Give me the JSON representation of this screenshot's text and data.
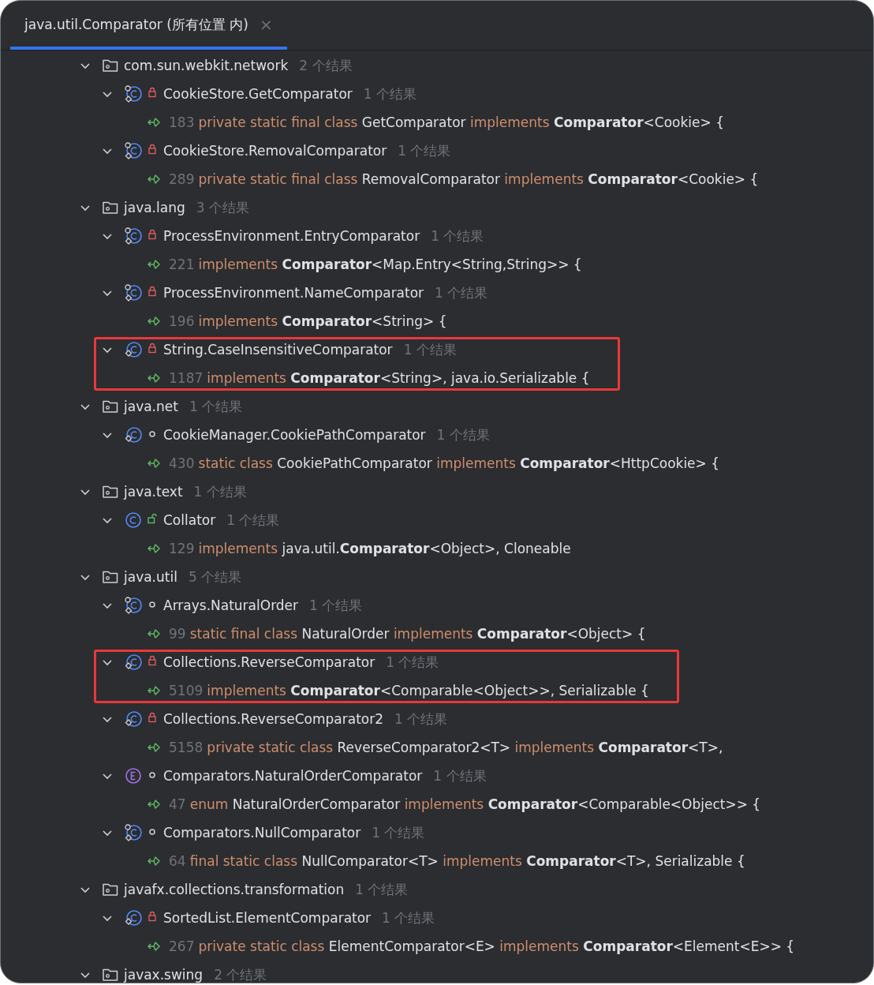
{
  "tabs": [
    {
      "label": "java.util.Comparator (所有位置 内)",
      "close": "×",
      "selected": true
    }
  ],
  "tree": [
    {
      "name": "com.sun.webkit.network",
      "count": "2 个结果",
      "expanded": true,
      "children": [
        {
          "name": "CookieStore.GetComparator",
          "count": "1 个结果",
          "kind": "nested",
          "modifier": {
            "kind": "private"
          },
          "expanded": true,
          "highlighted": false,
          "children": [
            {
              "line": "183",
              "segments": [
                {
                  "kind": "keyword",
                  "text": "private static final class "
                },
                {
                  "kind": "text",
                  "text": "GetComparator "
                },
                {
                  "kind": "keyword",
                  "text": "implements "
                },
                {
                  "kind": "bold",
                  "text": "Comparator"
                },
                {
                  "kind": "text",
                  "text": "<Cookie> {"
                }
              ]
            }
          ]
        },
        {
          "name": "CookieStore.RemovalComparator",
          "count": "1 个结果",
          "kind": "nested",
          "modifier": {
            "kind": "private"
          },
          "expanded": true,
          "highlighted": false,
          "children": [
            {
              "line": "289",
              "segments": [
                {
                  "kind": "keyword",
                  "text": "private static final class "
                },
                {
                  "kind": "text",
                  "text": "RemovalComparator "
                },
                {
                  "kind": "keyword",
                  "text": "implements "
                },
                {
                  "kind": "bold",
                  "text": "Comparator"
                },
                {
                  "kind": "text",
                  "text": "<Cookie> {"
                }
              ]
            }
          ]
        }
      ]
    },
    {
      "name": "java.lang",
      "count": "3 个结果",
      "expanded": true,
      "children": [
        {
          "name": "ProcessEnvironment.EntryComparator",
          "count": "1 个结果",
          "kind": "nested",
          "modifier": {
            "kind": "private"
          },
          "expanded": true,
          "highlighted": false,
          "children": [
            {
              "line": "221",
              "segments": [
                {
                  "kind": "keyword",
                  "text": "implements "
                },
                {
                  "kind": "bold",
                  "text": "Comparator"
                },
                {
                  "kind": "text",
                  "text": "<Map.Entry<String,String>> {"
                }
              ]
            }
          ]
        },
        {
          "name": "ProcessEnvironment.NameComparator",
          "count": "1 个结果",
          "kind": "nested",
          "modifier": {
            "kind": "private"
          },
          "expanded": true,
          "highlighted": false,
          "children": [
            {
              "line": "196",
              "segments": [
                {
                  "kind": "keyword",
                  "text": "implements "
                },
                {
                  "kind": "bold",
                  "text": "Comparator"
                },
                {
                  "kind": "text",
                  "text": "<String> {"
                }
              ]
            }
          ]
        },
        {
          "name": "String.CaseInsensitiveComparator",
          "count": "1 个结果",
          "kind": "inner",
          "modifier": {
            "kind": "private"
          },
          "expanded": true,
          "highlighted": true,
          "children": [
            {
              "line": "1187",
              "segments": [
                {
                  "kind": "keyword",
                  "text": "implements "
                },
                {
                  "kind": "bold",
                  "text": "Comparator"
                },
                {
                  "kind": "text",
                  "text": "<String>, java.io.Serializable {"
                }
              ]
            }
          ]
        }
      ]
    },
    {
      "name": "java.net",
      "count": "1 个结果",
      "expanded": true,
      "children": [
        {
          "name": "CookieManager.CookiePathComparator",
          "count": "1 个结果",
          "kind": "inner",
          "modifier": {
            "kind": "package"
          },
          "expanded": true,
          "highlighted": false,
          "children": [
            {
              "line": "430",
              "segments": [
                {
                  "kind": "keyword",
                  "text": "static class "
                },
                {
                  "kind": "text",
                  "text": "CookiePathComparator "
                },
                {
                  "kind": "keyword",
                  "text": "implements "
                },
                {
                  "kind": "bold",
                  "text": "Comparator"
                },
                {
                  "kind": "text",
                  "text": "<HttpCookie> {"
                }
              ]
            }
          ]
        }
      ]
    },
    {
      "name": "java.text",
      "count": "1 个结果",
      "expanded": true,
      "children": [
        {
          "name": "Collator",
          "count": "1 个结果",
          "kind": "class",
          "modifier": {
            "kind": "public"
          },
          "expanded": true,
          "highlighted": false,
          "children": [
            {
              "line": "129",
              "segments": [
                {
                  "kind": "keyword",
                  "text": "implements "
                },
                {
                  "kind": "text",
                  "text": "java.util."
                },
                {
                  "kind": "bold",
                  "text": "Comparator"
                },
                {
                  "kind": "text",
                  "text": "<Object>, Cloneable"
                }
              ]
            }
          ]
        }
      ]
    },
    {
      "name": "java.util",
      "count": "5 个结果",
      "expanded": true,
      "children": [
        {
          "name": "Arrays.NaturalOrder",
          "count": "1 个结果",
          "kind": "nested",
          "modifier": {
            "kind": "package"
          },
          "expanded": true,
          "highlighted": false,
          "children": [
            {
              "line": "99",
              "segments": [
                {
                  "kind": "keyword",
                  "text": "static final class "
                },
                {
                  "kind": "text",
                  "text": "NaturalOrder "
                },
                {
                  "kind": "keyword",
                  "text": "implements "
                },
                {
                  "kind": "bold",
                  "text": "Comparator"
                },
                {
                  "kind": "text",
                  "text": "<Object> {"
                }
              ]
            }
          ]
        },
        {
          "name": "Collections.ReverseComparator",
          "count": "1 个结果",
          "kind": "inner",
          "modifier": {
            "kind": "private"
          },
          "expanded": true,
          "highlighted": true,
          "children": [
            {
              "line": "5109",
              "segments": [
                {
                  "kind": "keyword",
                  "text": "implements "
                },
                {
                  "kind": "bold",
                  "text": "Comparator"
                },
                {
                  "kind": "text",
                  "text": "<Comparable<Object>>, Serializable {"
                }
              ]
            }
          ]
        },
        {
          "name": "Collections.ReverseComparator2",
          "count": "1 个结果",
          "kind": "inner",
          "modifier": {
            "kind": "private"
          },
          "expanded": true,
          "highlighted": false,
          "children": [
            {
              "line": "5158",
              "segments": [
                {
                  "kind": "keyword",
                  "text": "private static class "
                },
                {
                  "kind": "text",
                  "text": "ReverseComparator2<T> "
                },
                {
                  "kind": "keyword",
                  "text": "implements "
                },
                {
                  "kind": "bold",
                  "text": "Comparator"
                },
                {
                  "kind": "text",
                  "text": "<T>,"
                }
              ]
            }
          ]
        },
        {
          "name": "Comparators.NaturalOrderComparator",
          "count": "1 个结果",
          "kind": "enum",
          "modifier": {
            "kind": "package"
          },
          "expanded": true,
          "highlighted": false,
          "children": [
            {
              "line": "47",
              "segments": [
                {
                  "kind": "keyword",
                  "text": "enum "
                },
                {
                  "kind": "text",
                  "text": "NaturalOrderComparator "
                },
                {
                  "kind": "keyword",
                  "text": "implements "
                },
                {
                  "kind": "bold",
                  "text": "Comparator"
                },
                {
                  "kind": "text",
                  "text": "<Comparable<Object>> {"
                }
              ]
            }
          ]
        },
        {
          "name": "Comparators.NullComparator",
          "count": "1 个结果",
          "kind": "nested",
          "modifier": {
            "kind": "package"
          },
          "expanded": true,
          "highlighted": false,
          "children": [
            {
              "line": "64",
              "segments": [
                {
                  "kind": "keyword",
                  "text": "final static class "
                },
                {
                  "kind": "text",
                  "text": "NullComparator<T> "
                },
                {
                  "kind": "keyword",
                  "text": "implements "
                },
                {
                  "kind": "bold",
                  "text": "Comparator"
                },
                {
                  "kind": "text",
                  "text": "<T>, Serializable {"
                }
              ]
            }
          ]
        }
      ]
    },
    {
      "name": "javafx.collections.transformation",
      "count": "1 个结果",
      "expanded": true,
      "children": [
        {
          "name": "SortedList.ElementComparator",
          "count": "1 个结果",
          "kind": "inner",
          "modifier": {
            "kind": "private"
          },
          "expanded": true,
          "highlighted": false,
          "children": [
            {
              "line": "267",
              "segments": [
                {
                  "kind": "keyword",
                  "text": "private static class "
                },
                {
                  "kind": "text",
                  "text": "ElementComparator<E> "
                },
                {
                  "kind": "keyword",
                  "text": "implements "
                },
                {
                  "kind": "bold",
                  "text": "Comparator"
                },
                {
                  "kind": "text",
                  "text": "<Element<E>> {"
                }
              ]
            }
          ]
        }
      ]
    },
    {
      "name": "javax.swing",
      "count": "2 个结果",
      "expanded": true
    }
  ]
}
